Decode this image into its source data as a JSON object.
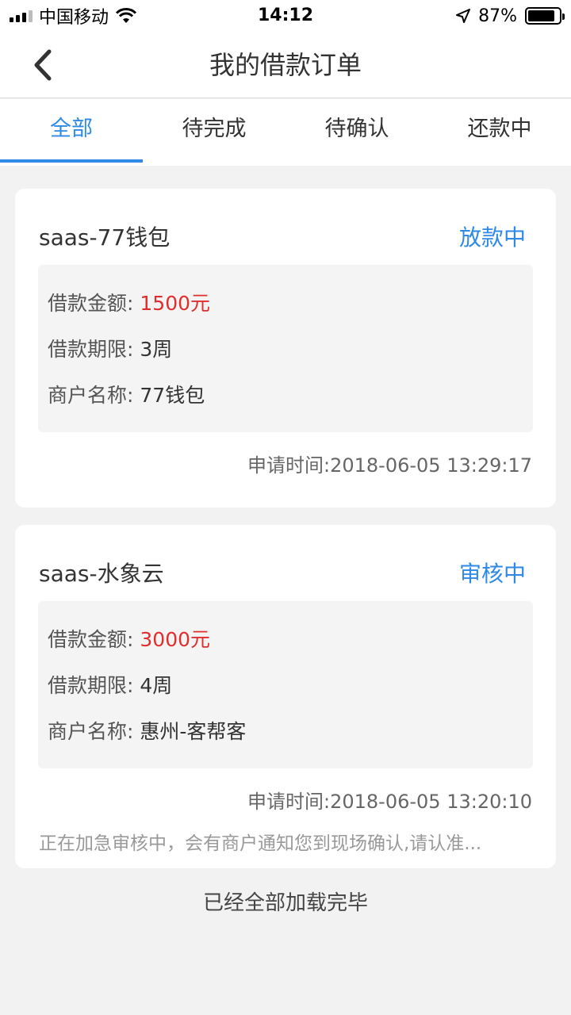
{
  "status_bar": {
    "carrier": "中国移动",
    "time": "14:12",
    "battery_text": "87%",
    "battery_level": 87
  },
  "nav": {
    "title": "我的借款订单"
  },
  "tabs": [
    {
      "label": "全部",
      "active": true
    },
    {
      "label": "待完成",
      "active": false
    },
    {
      "label": "待确认",
      "active": false
    },
    {
      "label": "还款中",
      "active": false
    }
  ],
  "orders": [
    {
      "name": "saas-77钱包",
      "status": "放款中",
      "amount_label": "借款金额:",
      "amount": "1500元",
      "term_label": "借款期限:",
      "term": "3周",
      "merchant_label": "商户名称:",
      "merchant": "77钱包",
      "apply_time": "申请时间:2018-06-05 13:29:17"
    },
    {
      "name": "saas-水象云",
      "status": "审核中",
      "amount_label": "借款金额:",
      "amount": "3000元",
      "term_label": "借款期限:",
      "term": "4周",
      "merchant_label": "商户名称:",
      "merchant": "惠州-客帮客",
      "apply_time": "申请时间:2018-06-05 13:20:10",
      "notice": "正在加急审核中，会有商户通知您到现场确认,请认准..."
    }
  ],
  "footer": {
    "load_done": "已经全部加载完毕"
  },
  "colors": {
    "accent": "#2e8ae6",
    "amount": "#e02e2e",
    "background": "#f2f2f2"
  }
}
